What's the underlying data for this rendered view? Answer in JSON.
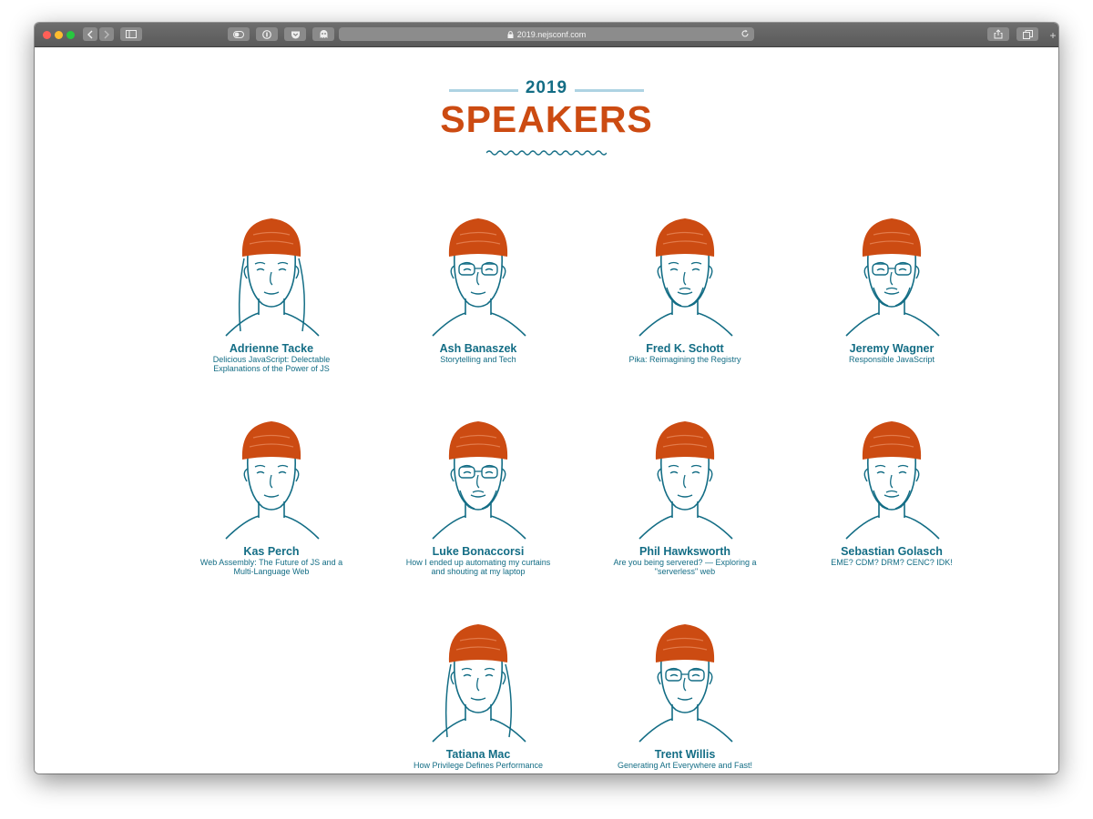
{
  "browser": {
    "url": "2019.nejsconf.com"
  },
  "page": {
    "year": "2019",
    "title": "SPEAKERS"
  },
  "colors": {
    "hat": "#cc4b12",
    "ink": "#136d85",
    "rule": "#aed3e3"
  },
  "speakers": [
    {
      "name": "Adrienne Tacke",
      "talk": "Delicious JavaScript: Delectable Explanations of the Power of JS"
    },
    {
      "name": "Ash Banaszek",
      "talk": "Storytelling and Tech"
    },
    {
      "name": "Fred K. Schott",
      "talk": "Pika: Reimagining the Registry"
    },
    {
      "name": "Jeremy Wagner",
      "talk": "Responsible JavaScript"
    },
    {
      "name": "Kas Perch",
      "talk": "Web Assembly: The Future of JS and a Multi-Language Web"
    },
    {
      "name": "Luke Bonaccorsi",
      "talk": "How I ended up automating my curtains and shouting at my laptop"
    },
    {
      "name": "Phil Hawksworth",
      "talk": "Are you being servered? — Exploring a \"serverless\" web"
    },
    {
      "name": "Sebastian Golasch",
      "talk": "EME? CDM? DRM? CENC? IDK!"
    },
    {
      "name": "Tatiana Mac",
      "talk": "How Privilege Defines Performance"
    },
    {
      "name": "Trent Willis",
      "talk": "Generating Art Everywhere and Fast!"
    }
  ]
}
